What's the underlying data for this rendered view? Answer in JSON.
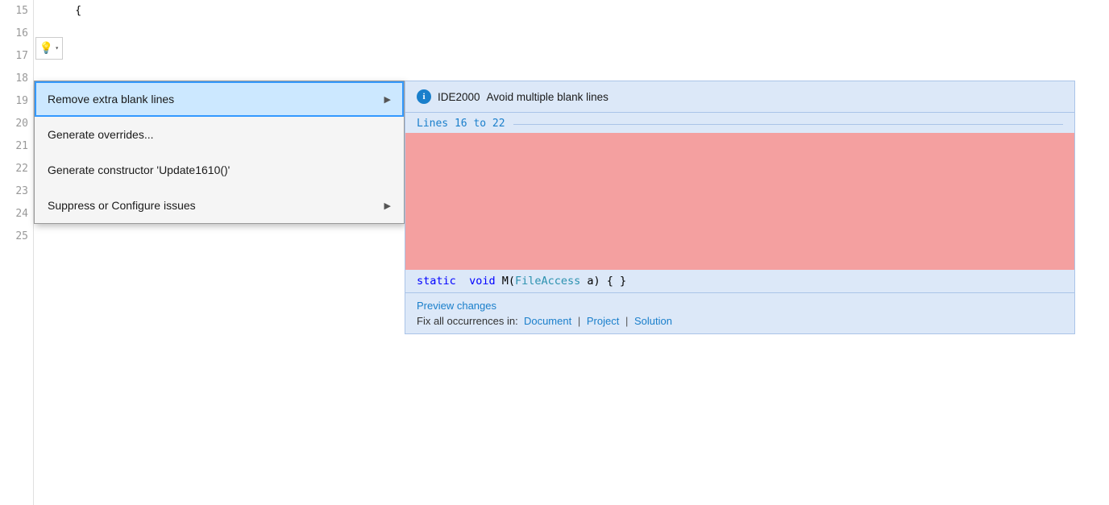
{
  "editor": {
    "background": "#ffffff",
    "lines": [
      {
        "number": "15",
        "content": "    {",
        "indent": 4
      },
      {
        "number": "16",
        "content": "",
        "indent": 0
      },
      {
        "number": "17",
        "content": "",
        "indent": 0
      },
      {
        "number": "18",
        "content": "",
        "indent": 0
      },
      {
        "number": "19",
        "content": "",
        "indent": 0
      },
      {
        "number": "20",
        "content": "",
        "indent": 0
      },
      {
        "number": "21",
        "content": "",
        "indent": 0
      },
      {
        "number": "22",
        "content": "        static voi",
        "indent": 8
      },
      {
        "number": "23",
        "content": "    }",
        "indent": 4
      },
      {
        "number": "24",
        "content": "}",
        "indent": 0
      },
      {
        "number": "25",
        "content": "",
        "indent": 0
      }
    ]
  },
  "lightbulb": {
    "icon": "💡",
    "dropdown_arrow": "▾"
  },
  "context_menu": {
    "items": [
      {
        "id": "remove-blank-lines",
        "label": "Remove extra blank lines",
        "has_arrow": true,
        "selected": true
      },
      {
        "id": "generate-overrides",
        "label": "Generate overrides...",
        "has_arrow": false,
        "selected": false
      },
      {
        "id": "generate-constructor",
        "label": "Generate constructor 'Update1610()'",
        "has_arrow": false,
        "selected": false
      },
      {
        "id": "suppress-configure",
        "label": "Suppress or Configure issues",
        "has_arrow": true,
        "selected": false
      }
    ]
  },
  "preview": {
    "info_icon": "i",
    "diagnostic_id": "IDE2000",
    "title": "Avoid multiple blank lines",
    "lines_range": "Lines 16 to 22",
    "code_preview": "static void M(FileAccess a) { }",
    "preview_changes_label": "Preview changes",
    "fix_all_prefix": "Fix all occurrences in:",
    "fix_targets": [
      {
        "label": "Document",
        "id": "fix-document"
      },
      {
        "label": "Project",
        "id": "fix-project"
      },
      {
        "label": "Solution",
        "id": "fix-solution"
      }
    ],
    "separator": "|"
  }
}
